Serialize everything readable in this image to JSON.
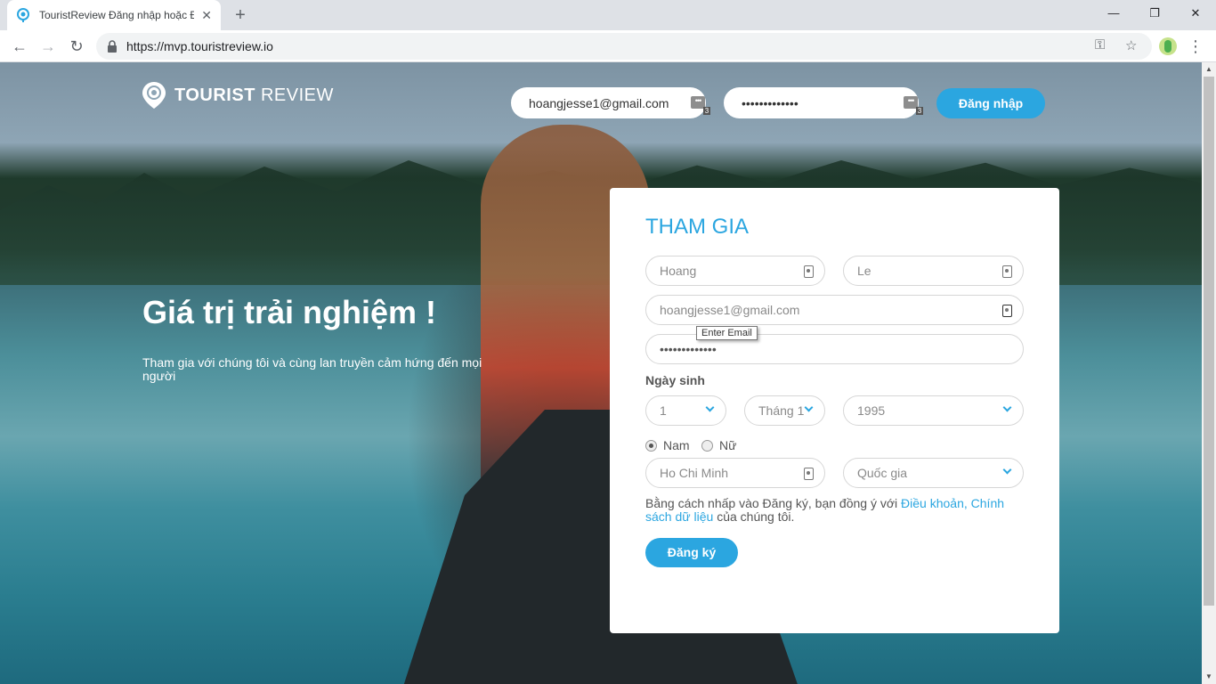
{
  "browser": {
    "tab_title": "TouristReview Đăng nhập hoặc Đ",
    "tab_close": "✕",
    "new_tab": "+",
    "url": "https://mvp.touristreview.io",
    "win_min": "—",
    "win_restore": "❐",
    "win_close": "✕",
    "back": "←",
    "forward": "→",
    "reload": "↻",
    "key_icon": "⚿",
    "star_icon": "☆",
    "menu": "⋮"
  },
  "logo": {
    "brand_bold": "TOURIST",
    "brand_light": " REVIEW"
  },
  "header_login": {
    "email_value": "hoangjesse1@gmail.com",
    "password_value": "•••••••••••••",
    "badge_dots": "•••",
    "badge_count": "3",
    "login_label": "Đăng nhập"
  },
  "hero": {
    "title": "Giá trị trải nghiệm !",
    "subtitle": "Tham gia với chúng tôi và cùng lan truyền cảm hứng đến mọi người"
  },
  "signup": {
    "title": "THAM GIA",
    "first_name": "Hoang",
    "last_name": "Le",
    "email": "hoangjesse1@gmail.com",
    "email_tooltip": "Enter Email",
    "password": "•••••••••••••",
    "dob_label": "Ngày sinh",
    "day": "1",
    "month": "Tháng 1",
    "year": "1995",
    "gender_male": "Nam",
    "gender_female": "Nữ",
    "city": "Ho Chi Minh",
    "country_placeholder": "Quốc gia",
    "terms_prefix": "Bằng cách nhấp vào Đăng ký, bạn đồng ý với ",
    "terms_link": "Điều khoản",
    "terms_sep": ", ",
    "privacy_link": "Chính sách dữ liệu",
    "terms_suffix": " của chúng tôi.",
    "submit_label": "Đăng ký"
  },
  "colors": {
    "accent": "#2ba6e0"
  }
}
